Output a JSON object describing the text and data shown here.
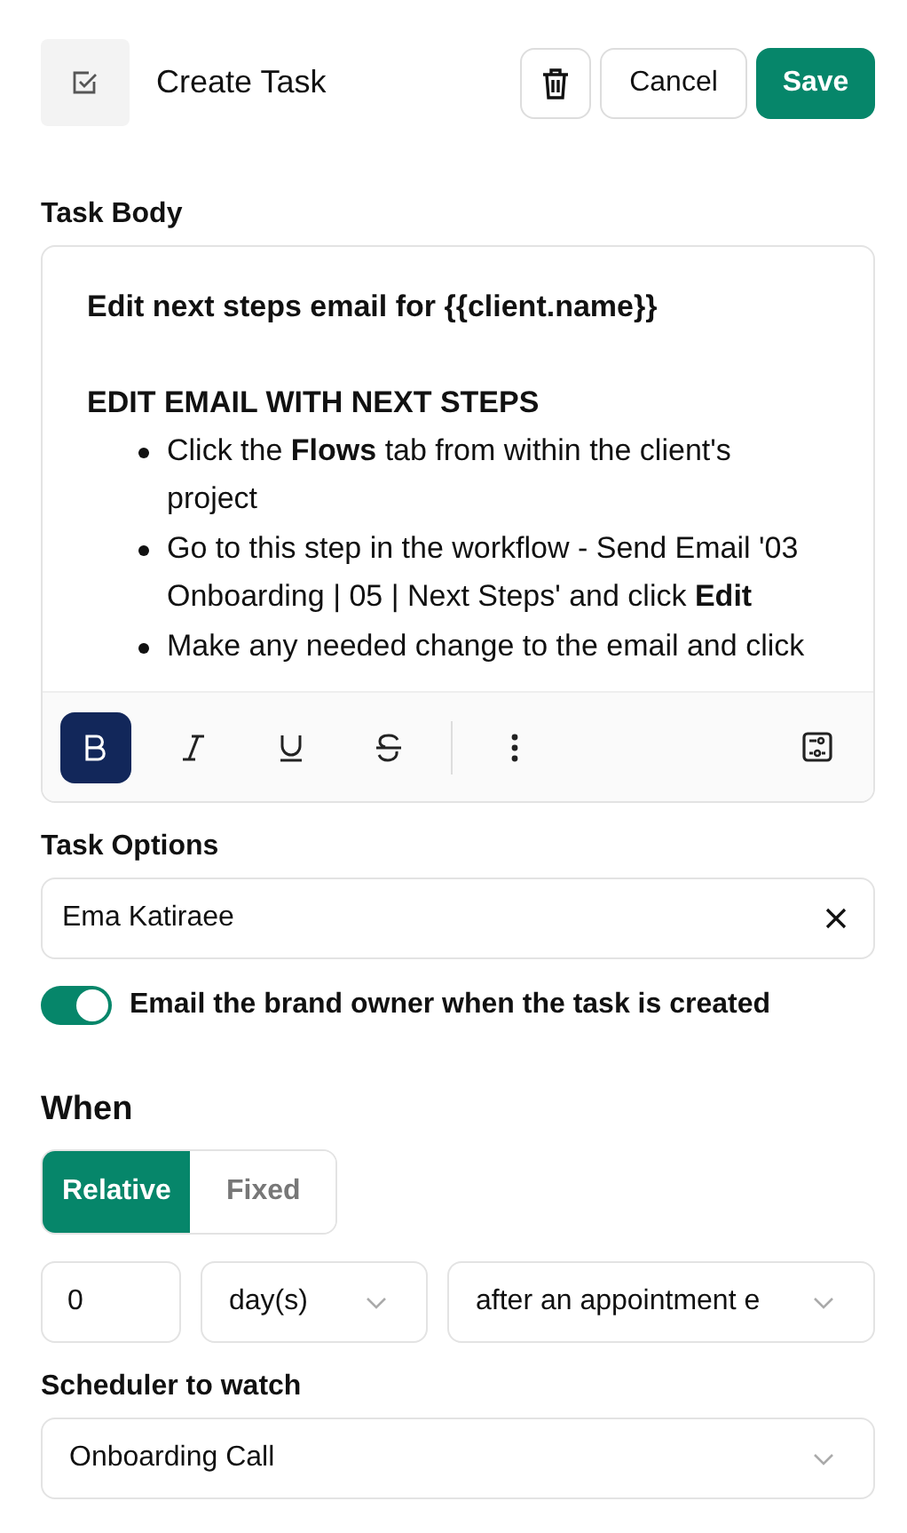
{
  "header": {
    "title": "Create Task",
    "buttons": [
      {
        "kind": "delete"
      },
      {
        "kind": "cancel",
        "label": "Cancel"
      },
      {
        "kind": "save",
        "label": "Save"
      }
    ]
  },
  "task_body": {
    "label": "Task Body",
    "heading": "Edit next steps email for {{client.name}}",
    "subheading": "EDIT EMAIL WITH NEXT STEPS",
    "bullets": [
      "Click the **Flows** tab from within the client's project",
      "Go to this step in the workflow - Send Email '03 Onboarding | 05 | Next Steps' and click **Edit**",
      "Make any needed change to the email and click"
    ],
    "toolbar": [
      {
        "kind": "bold",
        "selected": true
      },
      {
        "kind": "italic",
        "selected": false
      },
      {
        "kind": "underline",
        "selected": false
      },
      {
        "kind": "strike",
        "selected": false
      },
      {
        "kind": "divider"
      },
      {
        "kind": "more",
        "selected": false
      },
      {
        "kind": "variables",
        "selected": false
      }
    ]
  },
  "task_options": {
    "label": "Task Options",
    "assignee": "Ema Katiraee"
  },
  "email_toggle": {
    "label": "Email the brand owner when the task is created",
    "on": true
  },
  "when": {
    "label": "When",
    "modes": [
      {
        "label": "Relative",
        "selected": true
      },
      {
        "label": "Fixed",
        "selected": false
      }
    ],
    "amount": "0",
    "unit": "day(s)",
    "anchor": "after an appointment e"
  },
  "scheduler": {
    "label": "Scheduler to watch",
    "value": "Onboarding Call"
  }
}
